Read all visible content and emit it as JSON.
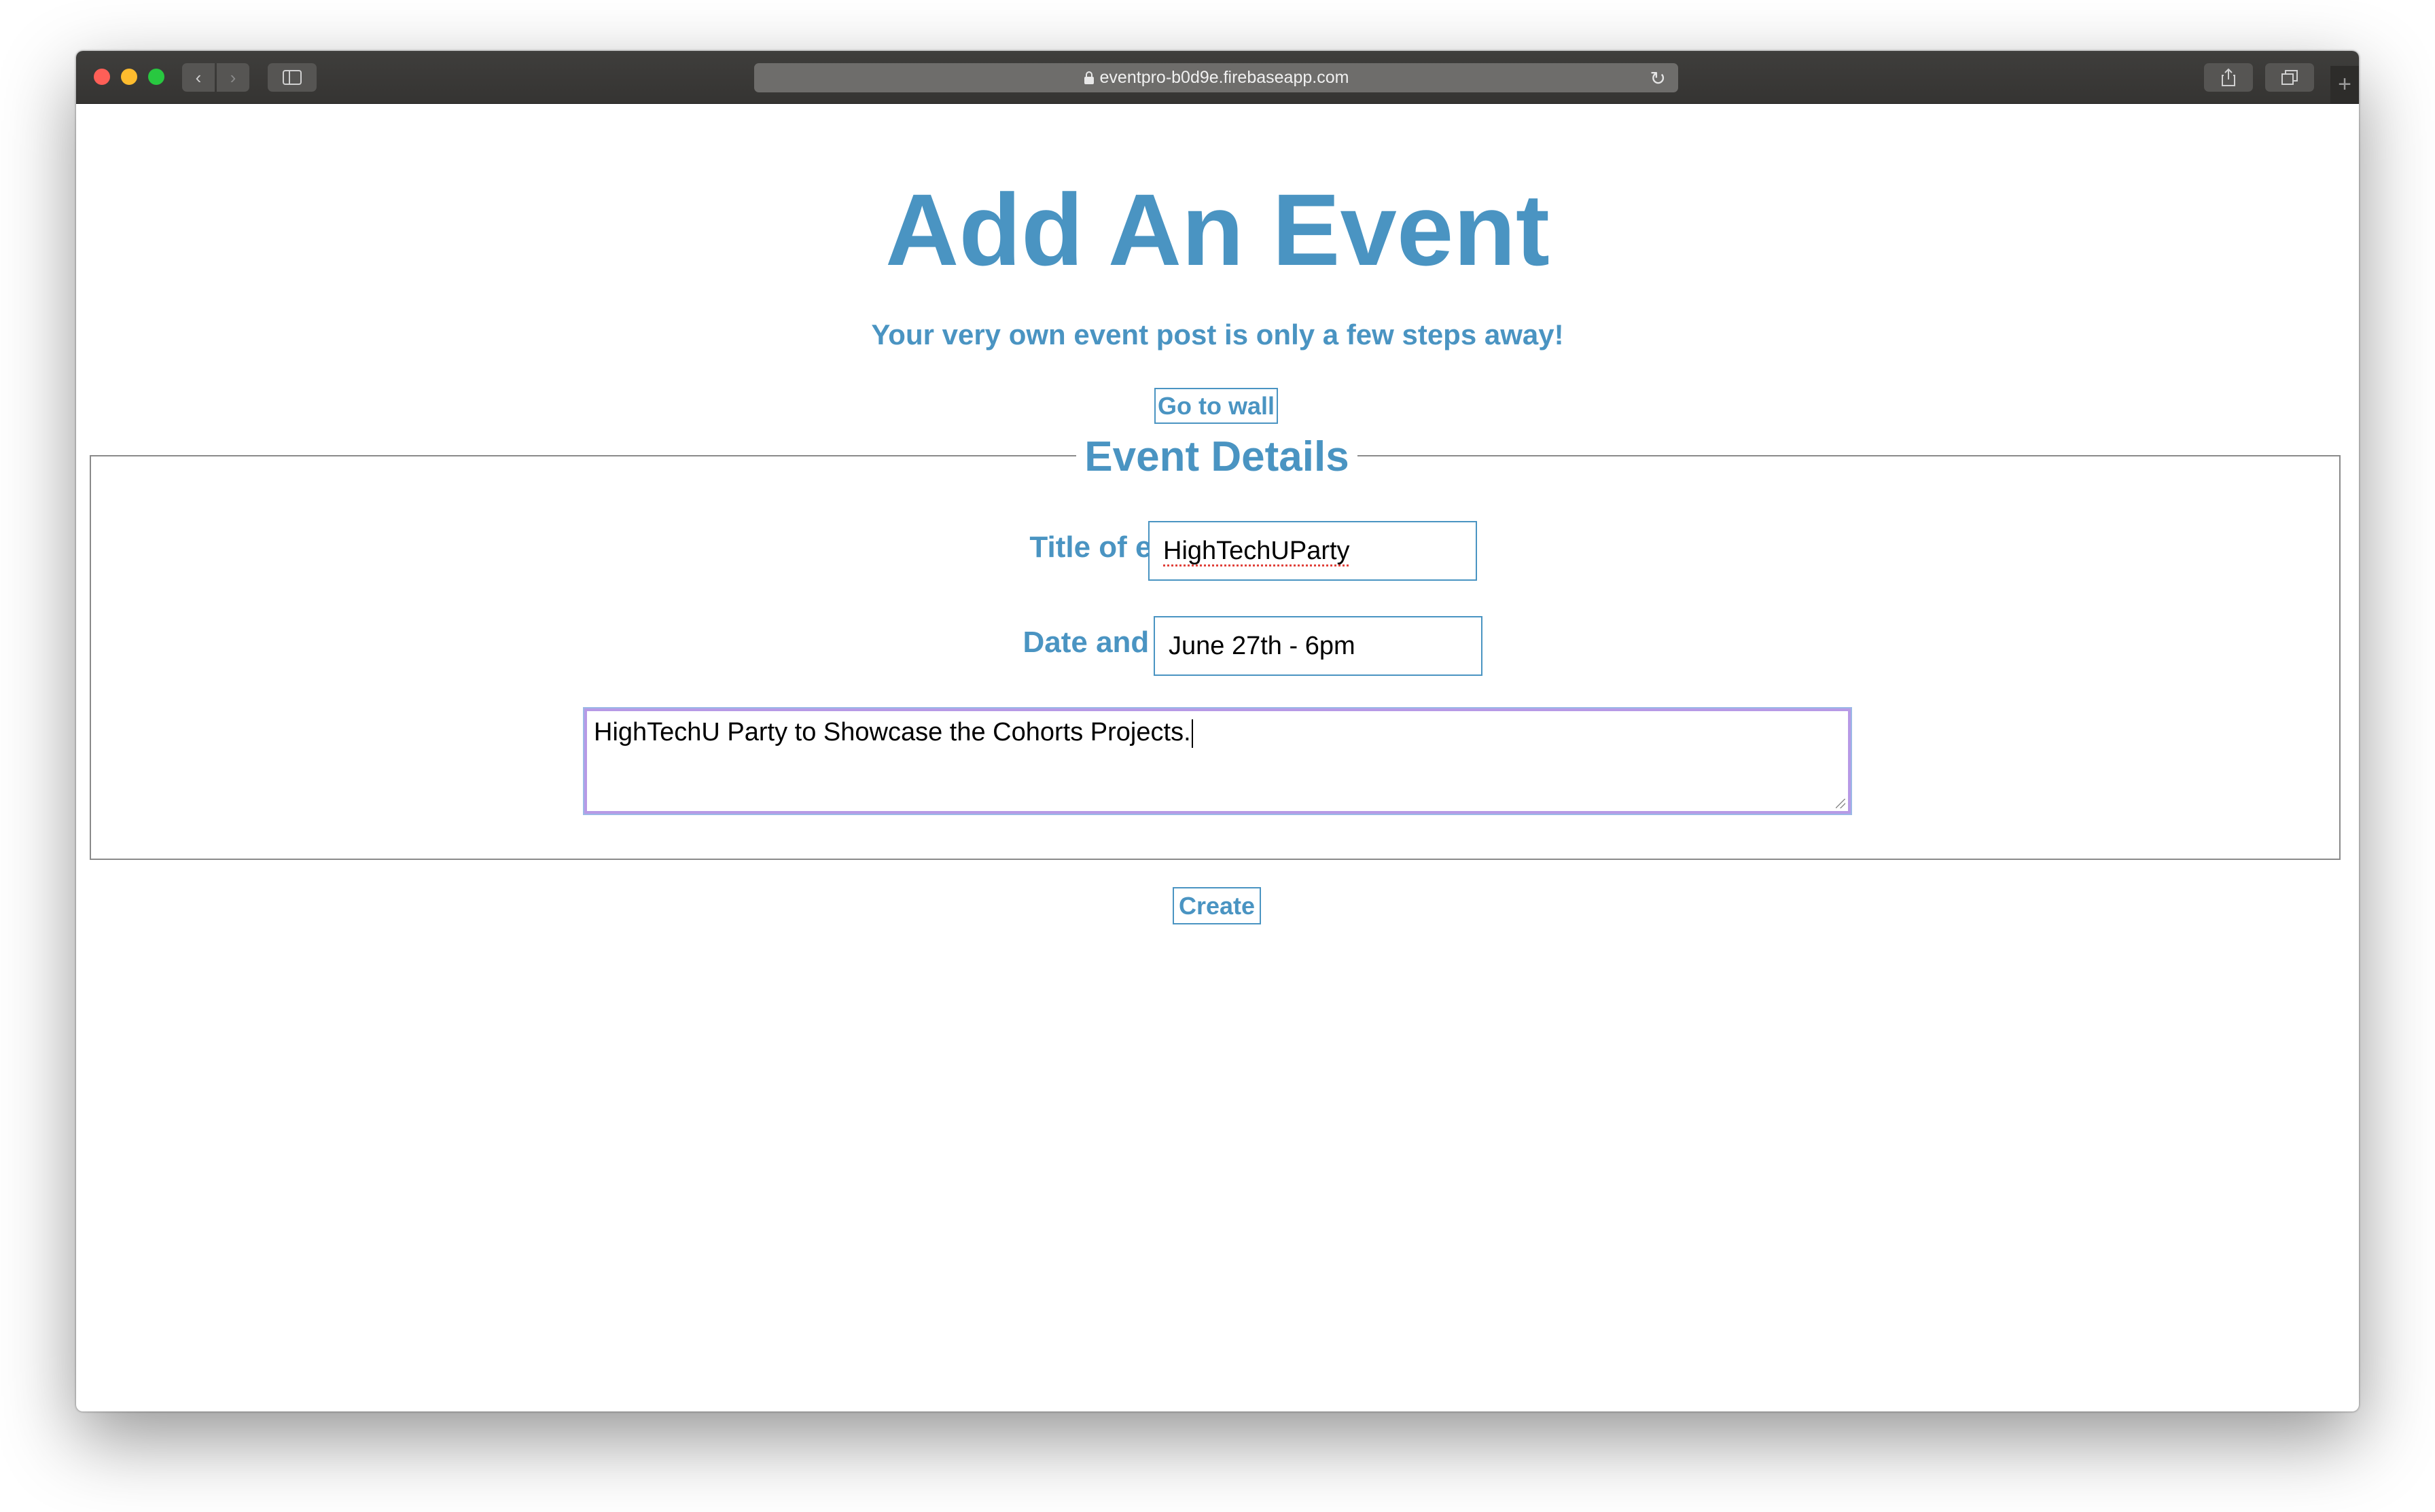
{
  "browser": {
    "url": "eventpro-b0d9e.firebaseapp.com"
  },
  "page": {
    "title": "Add An Event",
    "subtitle": "Your very own event post is only a few steps away!",
    "wall_button": "Go to wall",
    "fieldset_legend": "Event Details",
    "create_button": "Create"
  },
  "form": {
    "title_label": "Title of event",
    "title_value": "HighTechUParty",
    "date_label": "Date and time",
    "date_value": "June 27th - 6pm",
    "description_value": "HighTechU Party to Showcase the Cohorts Projects."
  },
  "colors": {
    "accent": "#4a94c2",
    "focus_ring": "#b79ae6"
  }
}
